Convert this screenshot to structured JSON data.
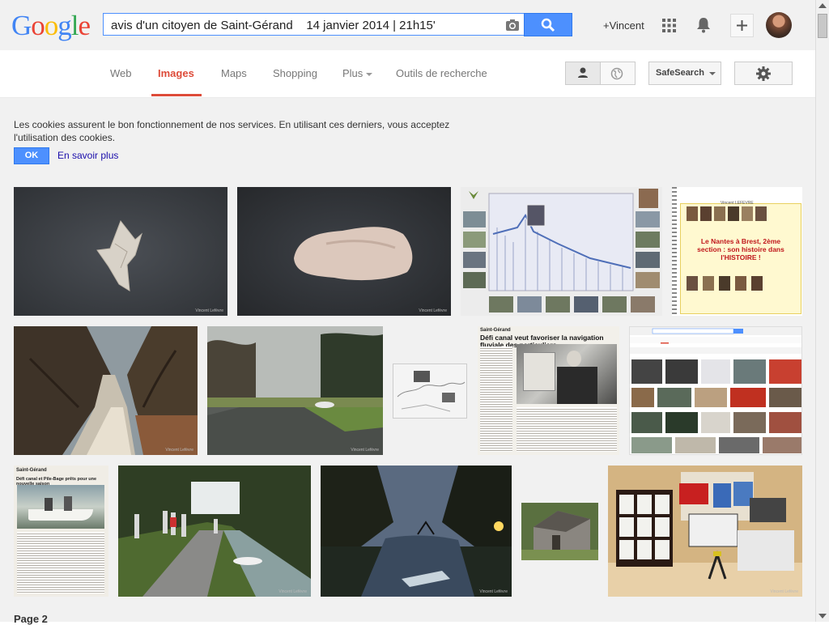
{
  "header": {
    "logo": "Google",
    "search_query": "avis d'un citoyen de Saint-Gérand    14 janvier 2014 | 21h15'",
    "plus_name": "+Vincent"
  },
  "nav": {
    "tabs": [
      "Web",
      "Images",
      "Maps",
      "Shopping",
      "Plus",
      "Outils de recherche"
    ],
    "active_tab": "Images",
    "safesearch_label": "SafeSearch"
  },
  "cookie": {
    "message": "Les cookies assurent le bon fonctionnement de nos services. En utilisant ces derniers, vous acceptez l'utilisation des cookies.",
    "ok_label": "OK",
    "learn_more": "En savoir plus"
  },
  "results": {
    "thumbnails": [
      {
        "subject": "flint-arrowhead"
      },
      {
        "subject": "flint-stone"
      },
      {
        "subject": "canal-profile-chart"
      },
      {
        "subject": "history-poster"
      },
      {
        "subject": "canal-tree-reflection"
      },
      {
        "subject": "canal-boat"
      },
      {
        "subject": "canal-map"
      },
      {
        "subject": "newspaper-article"
      },
      {
        "subject": "search-screenshot"
      },
      {
        "subject": "newspaper-boat"
      },
      {
        "subject": "towpath-walkers"
      },
      {
        "subject": "canal-sunset"
      },
      {
        "subject": "stone-cottage"
      },
      {
        "subject": "exhibition-boards"
      }
    ],
    "poster_title": "Le Nantes à Brest, 2ème section : son histoire dans l'HISTOIRE !",
    "poster_author": "Vincent LEFEVRE",
    "news_title": "Défi canal veut favoriser la navigation fluviale des particuliers",
    "news_town": "Saint-Gérand",
    "news2_title": "Défi canal et Pile-Bage prêts pour une nouvelle saison",
    "watermark": "Vincent Lefèvre"
  },
  "footer": {
    "page_label": "Page 2"
  },
  "colors": {
    "google_blue": "#4285f4",
    "google_red": "#ea4335",
    "google_yellow": "#fbbc05",
    "google_green": "#34a853",
    "active_tab": "#dd4b39",
    "button_blue": "#4d90fe"
  }
}
